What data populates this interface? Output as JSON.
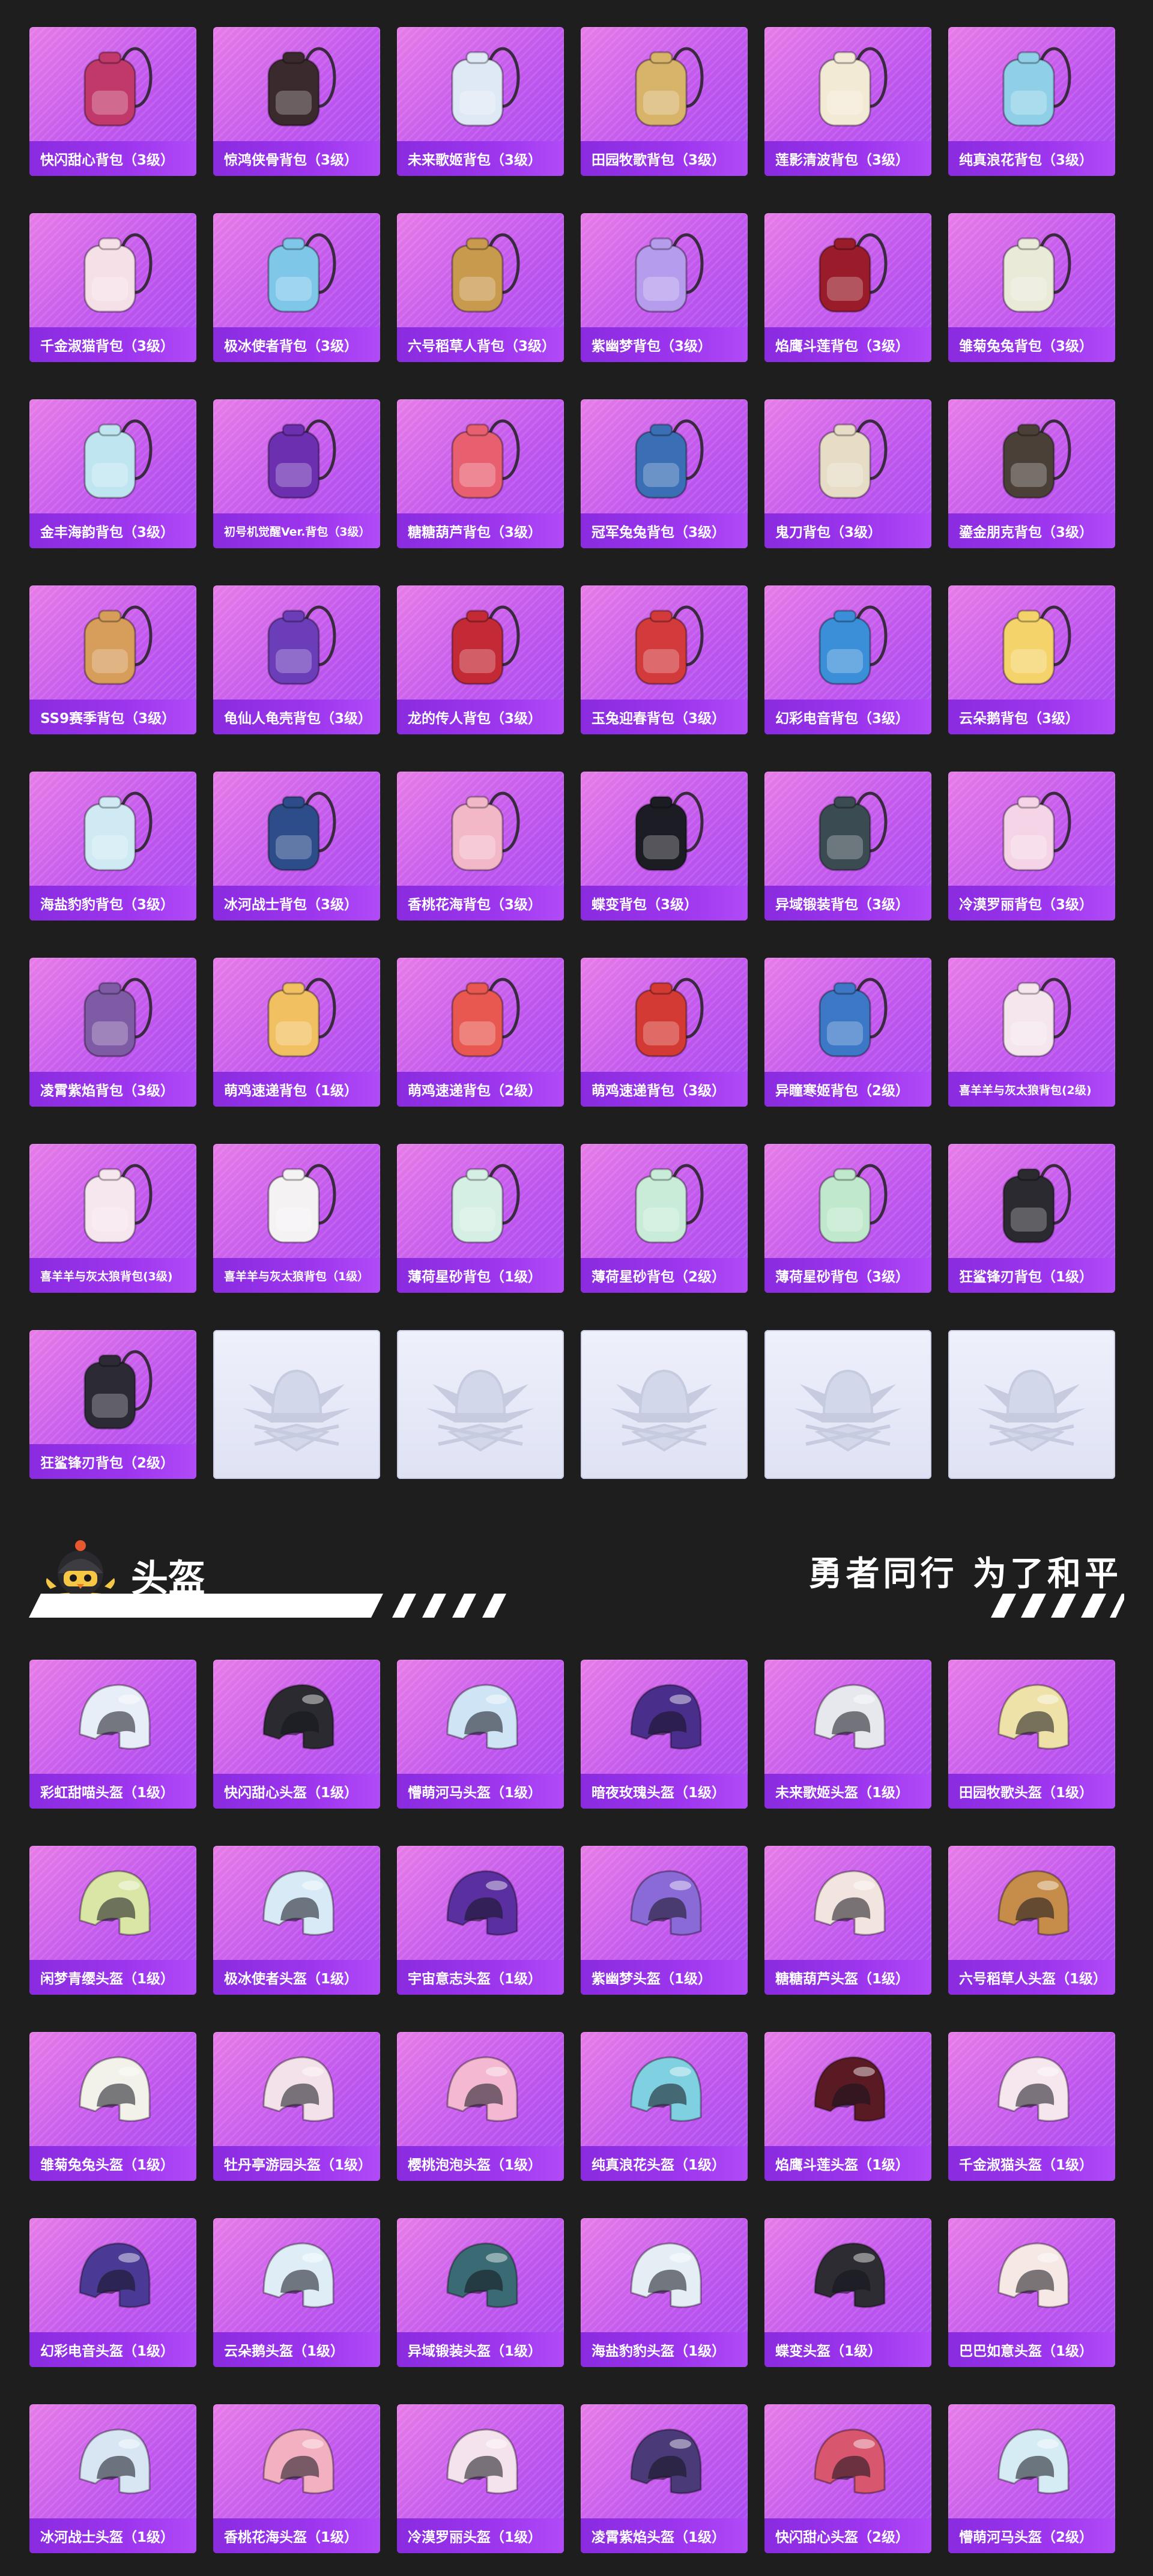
{
  "backpacks": [
    {
      "label": "快闪甜心背包（3级）",
      "icon": "backpack-pink-heart-icon",
      "color": "#c0396a"
    },
    {
      "label": "惊鸿侠骨背包（3级）",
      "icon": "backpack-dark-armor-icon",
      "color": "#3a2a2e"
    },
    {
      "label": "未来歌姬背包（3级）",
      "icon": "backpack-songstress-icon",
      "color": "#dfe9f5"
    },
    {
      "label": "田园牧歌背包（3级）",
      "icon": "backpack-basket-icon",
      "color": "#d8b36a"
    },
    {
      "label": "莲影清波背包（3级）",
      "icon": "backpack-lotus-icon",
      "color": "#f3ead6"
    },
    {
      "label": "纯真浪花背包（3级）",
      "icon": "backpack-cup-icon",
      "color": "#8fd0e8"
    },
    {
      "label": "千金淑猫背包（3级）",
      "icon": "backpack-cat-icon",
      "color": "#f6e0e8"
    },
    {
      "label": "极冰使者背包（3级）",
      "icon": "backpack-ice-icon",
      "color": "#7fc7e8"
    },
    {
      "label": "六号稻草人背包（3级）",
      "icon": "backpack-scarecrow-icon",
      "color": "#c89a4e"
    },
    {
      "label": "紫幽梦背包（3级）",
      "icon": "backpack-purple-dream-icon",
      "color": "#b59cec"
    },
    {
      "label": "焰鹰斗莲背包（3级）",
      "icon": "backpack-flame-eagle-icon",
      "color": "#9a1c2a"
    },
    {
      "label": "雏菊兔兔背包（3级）",
      "icon": "backpack-daisy-bunny-icon",
      "color": "#e9ead8"
    },
    {
      "label": "金丰海韵背包（3级）",
      "icon": "backpack-crystal-ball-icon",
      "color": "#bfe6f0"
    },
    {
      "label": "初号机觉醒Ver.背包（3级）",
      "icon": "backpack-eva-icon",
      "color": "#6b2fb0"
    },
    {
      "label": "糖糖葫芦背包（3级）",
      "icon": "backpack-candy-gourd-icon",
      "color": "#e86070"
    },
    {
      "label": "冠军兔兔背包（3级）",
      "icon": "backpack-champion-icon",
      "color": "#3b6fb5"
    },
    {
      "label": "鬼刀背包（3级）",
      "icon": "backpack-blade-icon",
      "color": "#e7dcc6"
    },
    {
      "label": "鎏金朋克背包（3级）",
      "icon": "backpack-gold-punk-icon",
      "color": "#4a4038"
    },
    {
      "label": "SS9赛季背包（3级）",
      "icon": "backpack-ss9-icon",
      "color": "#d79d5a"
    },
    {
      "label": "龟仙人龟壳背包（3级）",
      "icon": "backpack-turtle-shell-icon",
      "color": "#6b3db8"
    },
    {
      "label": "龙的传人背包（3级）",
      "icon": "backpack-dragon-icon",
      "color": "#c32a36"
    },
    {
      "label": "玉兔迎春背包（3级）",
      "icon": "backpack-jade-rabbit-icon",
      "color": "#d23a3c"
    },
    {
      "label": "幻彩电音背包（3级）",
      "icon": "backpack-speaker-icon",
      "color": "#3a8fd8"
    },
    {
      "label": "云朵鹅背包（3级）",
      "icon": "backpack-cloud-duck-icon",
      "color": "#f4d36a"
    },
    {
      "label": "海盐豹豹背包（3级）",
      "icon": "backpack-seal-icon",
      "color": "#cfeaf3"
    },
    {
      "label": "冰河战士背包（3级）",
      "icon": "backpack-glacier-icon",
      "color": "#2d4c8a"
    },
    {
      "label": "香桃花海背包（3级）",
      "icon": "backpack-peach-icon",
      "color": "#f3b8c8"
    },
    {
      "label": "蝶变背包（3级）",
      "icon": "backpack-butterfly-icon",
      "color": "#1c1c24"
    },
    {
      "label": "异域锻装背包（3级）",
      "icon": "backpack-exotic-icon",
      "color": "#3b4b52"
    },
    {
      "label": "冷漠罗丽背包（3级）",
      "icon": "backpack-lolita-icon",
      "color": "#f4d4e6"
    },
    {
      "label": "凌霄紫焰背包（3级）",
      "icon": "backpack-purple-flame-icon",
      "color": "#7e5ba4"
    },
    {
      "label": "萌鸡速递背包（1级）",
      "icon": "backpack-chick-icon",
      "color": "#f1c060"
    },
    {
      "label": "萌鸡速递背包（2级）",
      "icon": "backpack-chick-icon",
      "color": "#e85850"
    },
    {
      "label": "萌鸡速递背包（3级）",
      "icon": "backpack-chick-icon",
      "color": "#d43a34"
    },
    {
      "label": "异瞳寒姬背包（2级）",
      "icon": "backpack-snow-princess-icon",
      "color": "#3c78c6"
    },
    {
      "label": "喜羊羊与灰太狼背包(2级)",
      "icon": "backpack-sheep-icon",
      "color": "#f4e6ec"
    },
    {
      "label": "喜羊羊与灰太狼背包(3级)",
      "icon": "backpack-sheep-icon",
      "color": "#f6e6ee"
    },
    {
      "label": "喜羊羊与灰太狼背包（1级）",
      "icon": "backpack-sheep-icon",
      "color": "#f5f2f4"
    },
    {
      "label": "薄荷星砂背包（1级）",
      "icon": "backpack-mint-icon",
      "color": "#d6efe4"
    },
    {
      "label": "薄荷星砂背包（2级）",
      "icon": "backpack-mint-icon",
      "color": "#c8ecd8"
    },
    {
      "label": "薄荷星砂背包（3级）",
      "icon": "backpack-mint-icon",
      "color": "#bfe8cc"
    },
    {
      "label": "狂鲨锋刃背包（1级）",
      "icon": "backpack-shark-icon",
      "color": "#2a2a30"
    },
    {
      "label": "狂鲨锋刃背包（2级）",
      "icon": "backpack-shark-icon",
      "color": "#2c2a34"
    }
  ],
  "placeholders": [
    {
      "icon": "emblem-placeholder-icon"
    },
    {
      "icon": "emblem-placeholder-icon"
    },
    {
      "icon": "emblem-placeholder-icon"
    },
    {
      "icon": "emblem-placeholder-icon"
    },
    {
      "icon": "emblem-placeholder-icon"
    }
  ],
  "section": {
    "title": "头盔",
    "slogan": "勇者同行 为了和平",
    "mascot_icon": "helmet-chick-mascot-icon"
  },
  "helmets": [
    {
      "label": "彩虹甜喵头盔（1级）",
      "icon": "helmet-icon",
      "color": "#e8eef8"
    },
    {
      "label": "快闪甜心头盔（1级）",
      "icon": "helmet-icon",
      "color": "#2a2a30"
    },
    {
      "label": "懵萌河马头盔（1级）",
      "icon": "helmet-icon",
      "color": "#cfe4f4"
    },
    {
      "label": "暗夜玫瑰头盔（1级）",
      "icon": "helmet-icon",
      "color": "#4a2e8c"
    },
    {
      "label": "未来歌姬头盔（1级）",
      "icon": "helmet-icon",
      "color": "#e6e8ee"
    },
    {
      "label": "田园牧歌头盔（1级）",
      "icon": "helmet-icon",
      "color": "#efe2a8"
    },
    {
      "label": "闲梦青缨头盔（1级）",
      "icon": "helmet-icon",
      "color": "#d9e6a6"
    },
    {
      "label": "极冰使者头盔（1级）",
      "icon": "helmet-icon",
      "color": "#d8eaf6"
    },
    {
      "label": "宇宙意志头盔（1级）",
      "icon": "helmet-icon",
      "color": "#5a2fa0"
    },
    {
      "label": "紫幽梦头盔（1级）",
      "icon": "helmet-icon",
      "color": "#8a6ad6"
    },
    {
      "label": "糖糖葫芦头盔（1级）",
      "icon": "helmet-icon",
      "color": "#f2e4de"
    },
    {
      "label": "六号稻草人头盔（1级）",
      "icon": "helmet-icon",
      "color": "#c58c4a"
    },
    {
      "label": "雏菊兔兔头盔（1级）",
      "icon": "helmet-icon",
      "color": "#f2f2ea"
    },
    {
      "label": "牡丹亭游园头盔（1级）",
      "icon": "helmet-icon",
      "color": "#f4e2ea"
    },
    {
      "label": "樱桃泡泡头盔（1级）",
      "icon": "helmet-icon",
      "color": "#f4b8d2"
    },
    {
      "label": "纯真浪花头盔（1级）",
      "icon": "helmet-icon",
      "color": "#7fd0e0"
    },
    {
      "label": "焰鹰斗莲头盔（1级）",
      "icon": "helmet-icon",
      "color": "#5a1a24"
    },
    {
      "label": "千金淑猫头盔（1级）",
      "icon": "helmet-icon",
      "color": "#f6e6ee"
    },
    {
      "label": "幻彩电音头盔（1级）",
      "icon": "helmet-icon",
      "color": "#4a3a96"
    },
    {
      "label": "云朵鹅头盔（1级）",
      "icon": "helmet-icon",
      "color": "#dfeef6"
    },
    {
      "label": "异域锻装头盔（1级）",
      "icon": "helmet-icon",
      "color": "#3a6a74"
    },
    {
      "label": "海盐豹豹头盔（1级）",
      "icon": "helmet-icon",
      "color": "#e4eef4"
    },
    {
      "label": "蝶变头盔（1级）",
      "icon": "helmet-icon",
      "color": "#2c2c32"
    },
    {
      "label": "巴巴如意头盔（1级）",
      "icon": "helmet-icon",
      "color": "#f6e8e4"
    },
    {
      "label": "冰河战士头盔（1级）",
      "icon": "helmet-icon",
      "color": "#d8e6f4"
    },
    {
      "label": "香桃花海头盔（1级）",
      "icon": "helmet-icon",
      "color": "#f2b0c0"
    },
    {
      "label": "冷漠罗丽头盔（1级）",
      "icon": "helmet-icon",
      "color": "#f4e2ec"
    },
    {
      "label": "凌霄紫焰头盔（1级）",
      "icon": "helmet-icon",
      "color": "#4a3a78"
    },
    {
      "label": "快闪甜心头盔（2级）",
      "icon": "helmet-icon",
      "color": "#d8566e"
    },
    {
      "label": "懵萌河马头盔（2级）",
      "icon": "helmet-icon",
      "color": "#d6ecf4"
    }
  ]
}
